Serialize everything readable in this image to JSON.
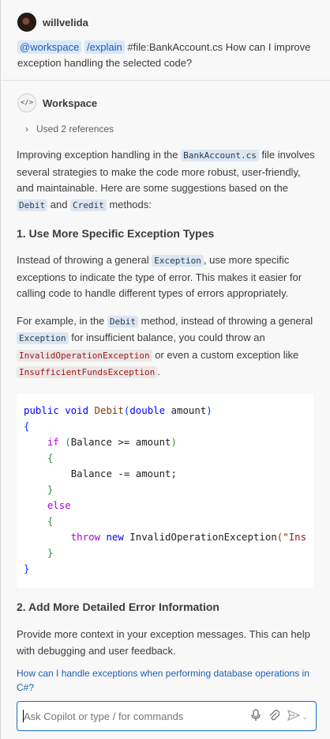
{
  "user": {
    "name": "willvelida",
    "prompt_agent": "@workspace",
    "prompt_command": "/explain",
    "prompt_file": "#file:BankAccount.cs",
    "prompt_text": " How can I improve exception handling the selected code?"
  },
  "response": {
    "agent_name": "Workspace",
    "references_label": "Used 2 references",
    "intro": {
      "p1": "Improving exception handling in the ",
      "file": "BankAccount.cs",
      "p2": " file involves several strategies to make the code more robust, user-friendly, and maintainable. Here are some suggestions based on the ",
      "m1": "Debit",
      "p3": " and ",
      "m2": "Credit",
      "p4": " methods:"
    },
    "section1": {
      "title": "1. Use More Specific Exception Types",
      "para1_a": "Instead of throwing a general ",
      "para1_code": "Exception",
      "para1_b": ", use more specific exceptions to indicate the type of error. This makes it easier for calling code to handle different types of errors appropriately.",
      "para2_a": "For example, in the ",
      "para2_code1": "Debit",
      "para2_b": " method, instead of throwing a general ",
      "para2_code2": "Exception",
      "para2_c": " for insufficient balance, you could throw an ",
      "para2_code3": "InvalidOperationException",
      "para2_d": " or even a custom exception like ",
      "para2_code4": "InsufficientFundsException",
      "para2_e": "."
    },
    "code": {
      "l1_kw": "public void ",
      "l1_name": "Debit",
      "l1_open": "(",
      "l1_type": "double",
      "l1_param": " amount",
      "l1_close": ")",
      "l2": "{",
      "l3_kw": "if ",
      "l3_open": "(",
      "l3_cond": "Balance >= amount",
      "l3_close": ")",
      "l4": "{",
      "l5": "Balance -= amount;",
      "l6": "}",
      "l7_kw": "else",
      "l8": "{",
      "l9_throw": "throw ",
      "l9_new": "new ",
      "l9_type": "InvalidOperationException",
      "l9_open": "(",
      "l9_str": "\"Ins",
      "l10": "}",
      "l11": "}"
    },
    "section2": {
      "title": "2. Add More Detailed Error Information",
      "para": "Provide more context in your exception messages. This can help with debugging and user feedback."
    }
  },
  "followup_link": "How can I handle exceptions when performing database operations in C#?",
  "input": {
    "placeholder": "Ask Copilot or type / for commands",
    "value": ""
  },
  "icons": {
    "mic": "microphone-icon",
    "attach": "paperclip-icon",
    "send": "send-icon",
    "send_menu": "chevron-down-icon",
    "references": "chevron-right-icon",
    "agent": "code-icon"
  }
}
